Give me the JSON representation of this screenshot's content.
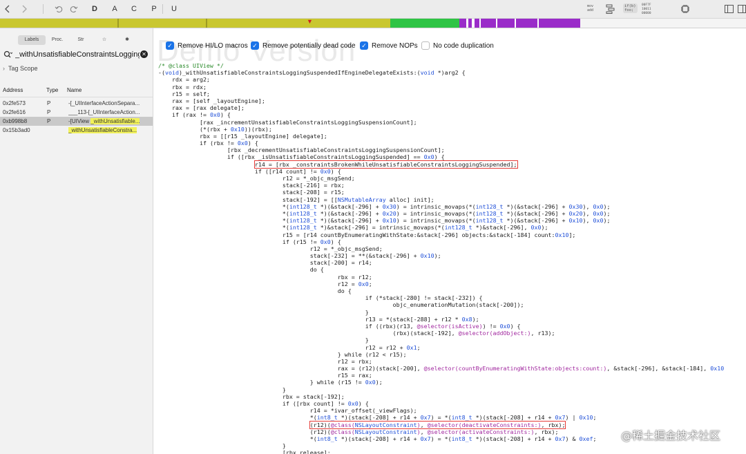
{
  "toolbar": {
    "back_icon": "chevron-left-icon",
    "forward_icon": "chevron-right-icon",
    "undo_icon": "undo-icon",
    "redo_icon": "redo-icon",
    "view_letters": [
      "D",
      "A",
      "C",
      "P",
      "U"
    ],
    "mov_add_label": "mov\nadd",
    "if_foo_label": "if(b)\nfoo;",
    "hex_label": "00F7F\n10011\n00000"
  },
  "navbar": {
    "colors": {
      "yellow": "#c9c730",
      "green": "#2fc445",
      "purple": "#9a2cc9",
      "violet": "#6f3cc4"
    }
  },
  "sidebar": {
    "tabs": [
      "Labels",
      "Proc.",
      "Str",
      "☆",
      "✱"
    ],
    "search_value": "_withUnsatisfiableConstraintsLogging",
    "tag_scope": "Tag Scope",
    "columns": [
      "Address",
      "Type",
      "Name"
    ],
    "rows": [
      {
        "address": "0x2fe573",
        "type": "P",
        "name_pre": "-[_UIInterfaceActionSepara...",
        "name_hl": "",
        "selected": false
      },
      {
        "address": "0x2fe616",
        "type": "P",
        "name_pre": "___113-[_UIInterfaceAction...",
        "name_hl": "",
        "selected": false
      },
      {
        "address": "0xb998b8",
        "type": "P",
        "name_pre": "-[UIView ",
        "name_hl": "_withUnsatisfiable...",
        "selected": true
      },
      {
        "address": "0x15b3ad0",
        "type": "",
        "name_pre": "",
        "name_hl": "_withUnsatisfiableConstra...",
        "selected": false
      }
    ]
  },
  "code": {
    "watermark": "Demo Version",
    "options": [
      {
        "label": "Remove HI/LO macros",
        "checked": true
      },
      {
        "label": "Remove potentially dead code",
        "checked": true
      },
      {
        "label": "Remove NOPs",
        "checked": true
      },
      {
        "label": "No code duplication",
        "checked": false
      }
    ],
    "lines": [
      {
        "t": "/* @class UIView */",
        "k": "comment"
      },
      {
        "t": "-(void)_withUnsatisfiableConstraintsLoggingSuspendedIfEngineDelegateExists:(void *)arg2 {"
      },
      {
        "t": "    rdx = arg2;"
      },
      {
        "t": "    rbx = rdx;"
      },
      {
        "t": "    r15 = self;"
      },
      {
        "t": "    rax = [self _layoutEngine];"
      },
      {
        "t": "    rax = [rax delegate];"
      },
      {
        "t": "    if (rax != 0x0) {"
      },
      {
        "t": "            [rax _incrementUnsatisfiableConstraintsLoggingSuspensionCount];"
      },
      {
        "t": "            (*(rbx + 0x10))(rbx);"
      },
      {
        "t": "            rbx = [[r15 _layoutEngine] delegate];"
      },
      {
        "t": "            if (rbx != 0x0) {"
      },
      {
        "t": "                    [rbx _decrementUnsatisfiableConstraintsLoggingSuspensionCount];"
      },
      {
        "t": "                    if ([rbx _isUnsatisfiableConstraintsLoggingSuspended] == 0x0) {"
      },
      {
        "t": "                            r14 = [rbx _constraintsBrokenWhileUnsatisfiableConstraintsLoggingSuspended];",
        "box": true
      },
      {
        "t": "                            if ([r14 count] != 0x0) {"
      },
      {
        "t": "                                    r12 = *_objc_msgSend;"
      },
      {
        "t": "                                    stack[-216] = rbx;"
      },
      {
        "t": "                                    stack[-208] = r15;"
      },
      {
        "t": "                                    stack[-192] = [[NSMutableArray alloc] init];"
      },
      {
        "t": "                                    *(int128_t *)(&stack[-296] + 0x30) = intrinsic_movaps(*(int128_t *)(&stack[-296] + 0x30), 0x0);"
      },
      {
        "t": "                                    *(int128_t *)(&stack[-296] + 0x20) = intrinsic_movaps(*(int128_t *)(&stack[-296] + 0x20), 0x0);"
      },
      {
        "t": "                                    *(int128_t *)(&stack[-296] + 0x10) = intrinsic_movaps(*(int128_t *)(&stack[-296] + 0x10), 0x0);"
      },
      {
        "t": "                                    *(int128_t *)&stack[-296] = intrinsic_movaps(*(int128_t *)&stack[-296], 0x0);"
      },
      {
        "t": "                                    r15 = [r14 countByEnumeratingWithState:&stack[-296] objects:&stack[-184] count:0x10];"
      },
      {
        "t": "                                    if (r15 != 0x0) {"
      },
      {
        "t": "                                            r12 = *_objc_msgSend;"
      },
      {
        "t": "                                            stack[-232] = **(&stack[-296] + 0x10);"
      },
      {
        "t": "                                            stack[-200] = r14;"
      },
      {
        "t": "                                            do {"
      },
      {
        "t": "                                                    rbx = r12;"
      },
      {
        "t": "                                                    r12 = 0x0;"
      },
      {
        "t": "                                                    do {"
      },
      {
        "t": "                                                            if (*stack[-280] != stack[-232]) {"
      },
      {
        "t": "                                                                    objc_enumerationMutation(stack[-200]);"
      },
      {
        "t": "                                                            }"
      },
      {
        "t": "                                                            r13 = *(stack[-288] + r12 * 0x8);"
      },
      {
        "t": "                                                            if ((rbx)(r13, @selector(isActive)) != 0x0) {"
      },
      {
        "t": "                                                                    (rbx)(stack[-192], @selector(addObject:), r13);"
      },
      {
        "t": "                                                            }"
      },
      {
        "t": "                                                            r12 = r12 + 0x1;"
      },
      {
        "t": "                                                    } while (r12 < r15);"
      },
      {
        "t": "                                                    r12 = rbx;"
      },
      {
        "t": "                                                    rax = (r12)(stack[-200], @selector(countByEnumeratingWithState:objects:count:), &stack[-296], &stack[-184], 0x10"
      },
      {
        "t": "                                                    r15 = rax;"
      },
      {
        "t": "                                            } while (r15 != 0x0);"
      },
      {
        "t": "                                    }"
      },
      {
        "t": "                                    rbx = stack[-192];"
      },
      {
        "t": "                                    if ([rbx count] != 0x0) {"
      },
      {
        "t": "                                            r14 = *ivar_offset(_viewFlags);"
      },
      {
        "t": "                                            *(int8_t *)(stack[-208] + r14 + 0x7) = *(int8_t *)(stack[-208] + r14 + 0x7) | 0x10;"
      },
      {
        "t": "                                            (r12)(@class(NSLayoutConstraint), @selector(deactivateConstraints:), rbx);",
        "box": true
      },
      {
        "t": "                                            (r12)(@class(NSLayoutConstraint), @selector(activateConstraints:), rbx);"
      },
      {
        "t": "                                            *(int8_t *)(stack[-208] + r14 + 0x7) = *(int8_t *)(stack[-208] + r14 + 0x7) & 0xef;"
      },
      {
        "t": "                                    }"
      },
      {
        "t": "                                    [rbx release];"
      }
    ]
  },
  "footer_watermark": "@稀土掘金技术社区"
}
